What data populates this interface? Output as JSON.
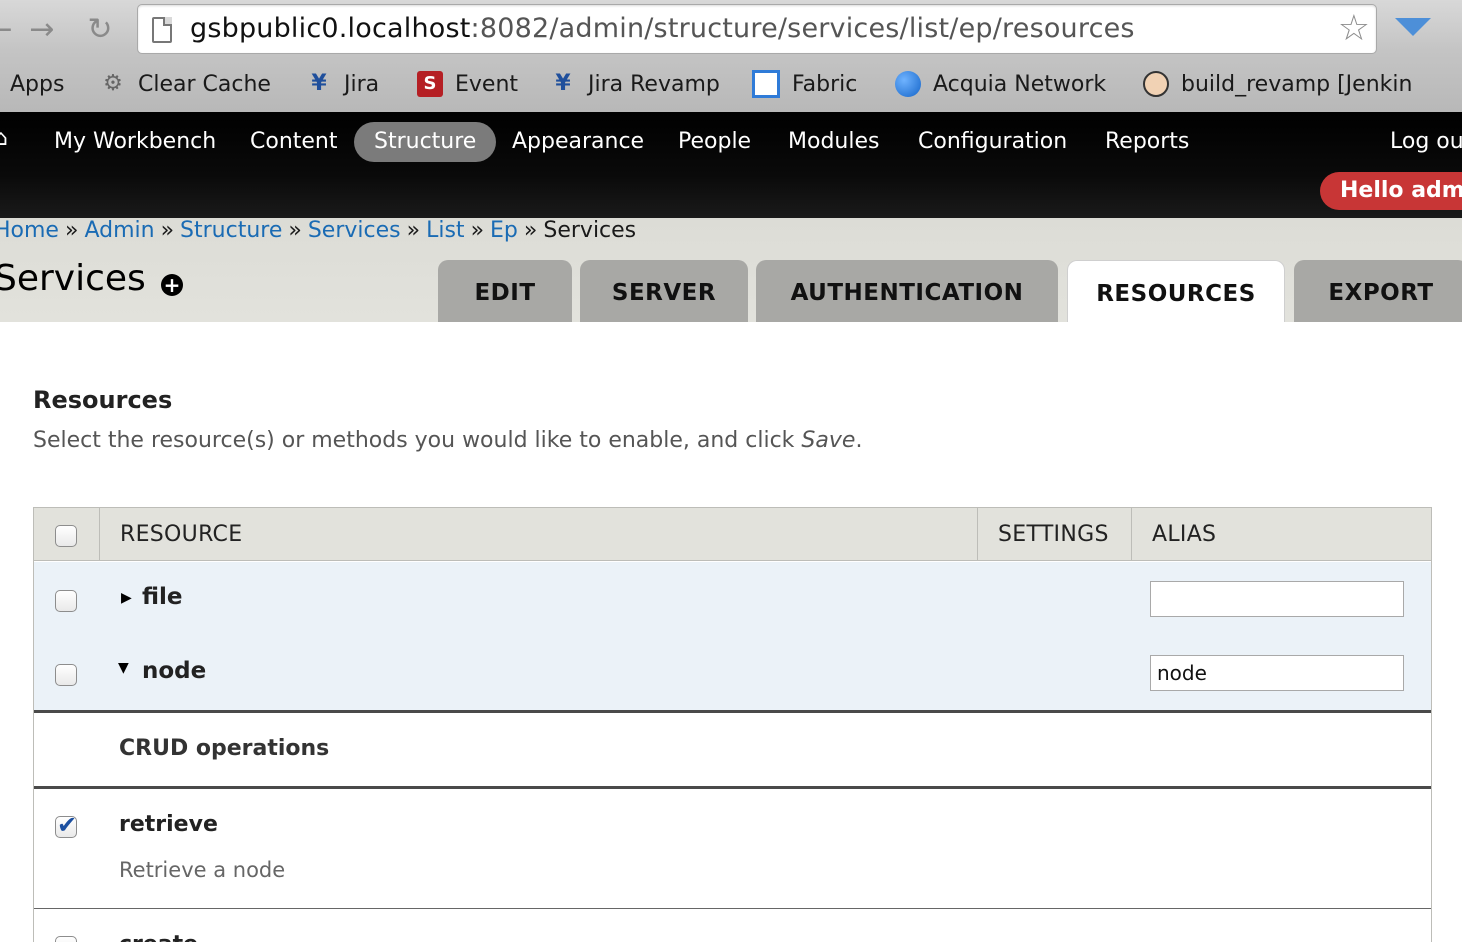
{
  "browser": {
    "url_host": "gsbpublic0.localhost",
    "url_path": ":8082/admin/structure/services/list/ep/resources",
    "bookmarks": [
      {
        "label": "Apps",
        "icon": "apps-icon"
      },
      {
        "label": "Clear Cache",
        "icon": "gear-icon"
      },
      {
        "label": "Jira",
        "icon": "jira-icon"
      },
      {
        "label": "Event",
        "icon": "event-icon"
      },
      {
        "label": "Jira Revamp",
        "icon": "jira-icon"
      },
      {
        "label": "Fabric",
        "icon": "fabric-icon"
      },
      {
        "label": "Acquia Network",
        "icon": "globe-icon"
      },
      {
        "label": "build_revamp [Jenkin",
        "icon": "jenkins-icon"
      }
    ]
  },
  "toolbar": {
    "items": [
      "My Workbench",
      "Content",
      "Structure",
      "Appearance",
      "People",
      "Modules",
      "Configuration",
      "Reports"
    ],
    "active": "Structure",
    "logout": "Log ou",
    "hello": "Hello admi"
  },
  "breadcrumb": {
    "items": [
      "Home",
      "Admin",
      "Structure",
      "Services",
      "List",
      "Ep"
    ],
    "current": "Services",
    "separator": "»"
  },
  "page": {
    "title": "Services",
    "tabs": [
      "EDIT",
      "SERVER",
      "AUTHENTICATION",
      "RESOURCES",
      "EXPORT"
    ],
    "active_tab": "RESOURCES"
  },
  "resources": {
    "heading": "Resources",
    "desc_before": "Select the resource(s) or methods you would like to enable, and click ",
    "desc_em": "Save",
    "desc_after": ".",
    "columns": [
      "RESOURCE",
      "SETTINGS",
      "ALIAS"
    ],
    "rows": [
      {
        "name": "file",
        "expanded": false,
        "checked": false,
        "alias": ""
      },
      {
        "name": "node",
        "expanded": true,
        "checked": false,
        "alias": "node"
      }
    ],
    "group_label": "CRUD operations",
    "operations": [
      {
        "name": "retrieve",
        "desc": "Retrieve a node",
        "checked": true
      },
      {
        "name": "create",
        "desc": "",
        "checked": false
      }
    ]
  },
  "colors": {
    "accent_link": "#1a6bb4",
    "hello_badge": "#c83636",
    "toolbar_bg": "#000000",
    "row_highlight": "#ebf2f8"
  }
}
